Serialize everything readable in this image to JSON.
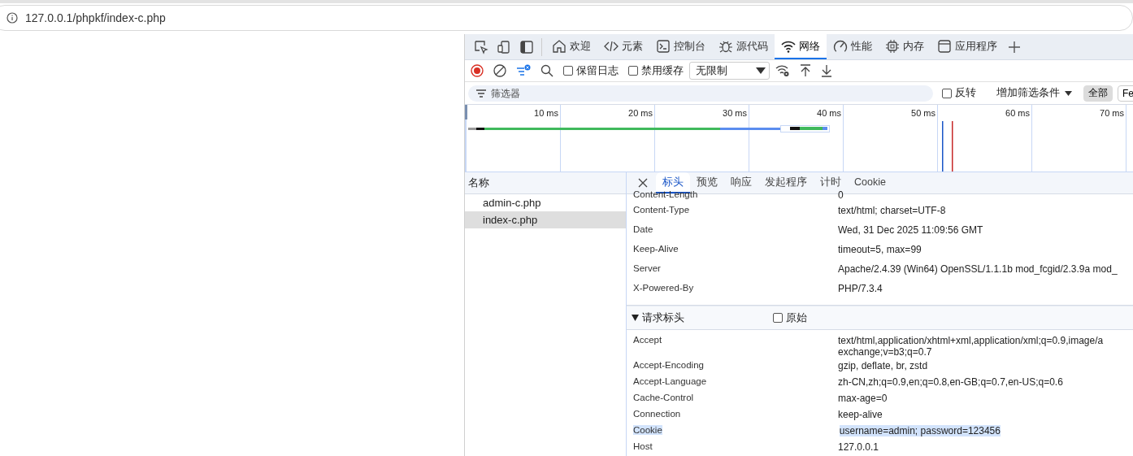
{
  "address_bar": {
    "url": "127.0.0.1/phpkf/index-c.php"
  },
  "devtools": {
    "tabs": [
      {
        "kind": "home",
        "label": "欢迎",
        "selected": false
      },
      {
        "kind": "code",
        "label": "元素",
        "selected": false
      },
      {
        "kind": "console",
        "label": "控制台",
        "selected": false
      },
      {
        "kind": "bug",
        "label": "源代码",
        "selected": false
      },
      {
        "kind": "wifi",
        "label": "网络",
        "selected": true
      },
      {
        "kind": "gauge",
        "label": "性能",
        "selected": false
      },
      {
        "kind": "chip",
        "label": "内存",
        "selected": false
      },
      {
        "kind": "window",
        "label": "应用程序",
        "selected": false
      }
    ],
    "toolbar": {
      "recording": true,
      "checkboxes": [
        {
          "label": "保留日志",
          "checked": false
        },
        {
          "label": "禁用缓存",
          "checked": false
        }
      ],
      "throttle": "无限制"
    },
    "filter": {
      "placeholder": "筛选器",
      "invert": {
        "label": "反转",
        "checked": false
      },
      "more": "增加筛选条件",
      "types": [
        {
          "label": "全部",
          "selected": true
        },
        {
          "label": "Fe",
          "selected": false
        }
      ]
    },
    "timeline": {
      "ticks": [
        "10 ms",
        "20 ms",
        "30 ms",
        "40 ms",
        "50 ms",
        "60 ms",
        "70 ms"
      ]
    },
    "requests": {
      "header": "名称",
      "items": [
        {
          "name": "admin-c.php",
          "selected": false
        },
        {
          "name": "index-c.php",
          "selected": true
        }
      ]
    },
    "detail_tabs": [
      {
        "label": "标头",
        "selected": true
      },
      {
        "label": "预览",
        "selected": false
      },
      {
        "label": "响应",
        "selected": false
      },
      {
        "label": "发起程序",
        "selected": false
      },
      {
        "label": "计时",
        "selected": false
      },
      {
        "label": "Cookie",
        "selected": false
      }
    ],
    "response_headers": [
      {
        "name": "Content-Length",
        "lines": [
          "0"
        ],
        "selected": false
      },
      {
        "name": "Content-Type",
        "lines": [
          "text/html; charset=UTF-8"
        ],
        "selected": false
      },
      {
        "name": "Date",
        "lines": [
          "Wed, 31 Dec 2025 11:09:56 GMT"
        ],
        "selected": false
      },
      {
        "name": "Keep-Alive",
        "lines": [
          "timeout=5, max=99"
        ],
        "selected": false
      },
      {
        "name": "Server",
        "lines": [
          "Apache/2.4.39 (Win64) OpenSSL/1.1.1b mod_fcgid/2.3.9a mod_"
        ],
        "selected": false
      },
      {
        "name": "X-Powered-By",
        "lines": [
          "PHP/7.3.4"
        ],
        "selected": false
      }
    ],
    "request_section": {
      "title": "请求标头",
      "expanded": true,
      "raw": {
        "label": "原始",
        "checked": false
      }
    },
    "request_headers": [
      {
        "name": "Accept",
        "lines": [
          "text/html,application/xhtml+xml,application/xml;q=0.9,image/a",
          "exchange;v=b3;q=0.7"
        ],
        "selected": false
      },
      {
        "name": "Accept-Encoding",
        "lines": [
          "gzip, deflate, br, zstd"
        ],
        "selected": false
      },
      {
        "name": "Accept-Language",
        "lines": [
          "zh-CN,zh;q=0.9,en;q=0.8,en-GB;q=0.7,en-US;q=0.6"
        ],
        "selected": false
      },
      {
        "name": "Cache-Control",
        "lines": [
          "max-age=0"
        ],
        "selected": false
      },
      {
        "name": "Connection",
        "lines": [
          "keep-alive"
        ],
        "selected": false
      },
      {
        "name": "Cookie",
        "lines": [
          "username=admin; password=123456"
        ],
        "selected": true
      },
      {
        "name": "Host",
        "lines": [
          "127.0.0.1"
        ],
        "selected": false
      }
    ]
  }
}
